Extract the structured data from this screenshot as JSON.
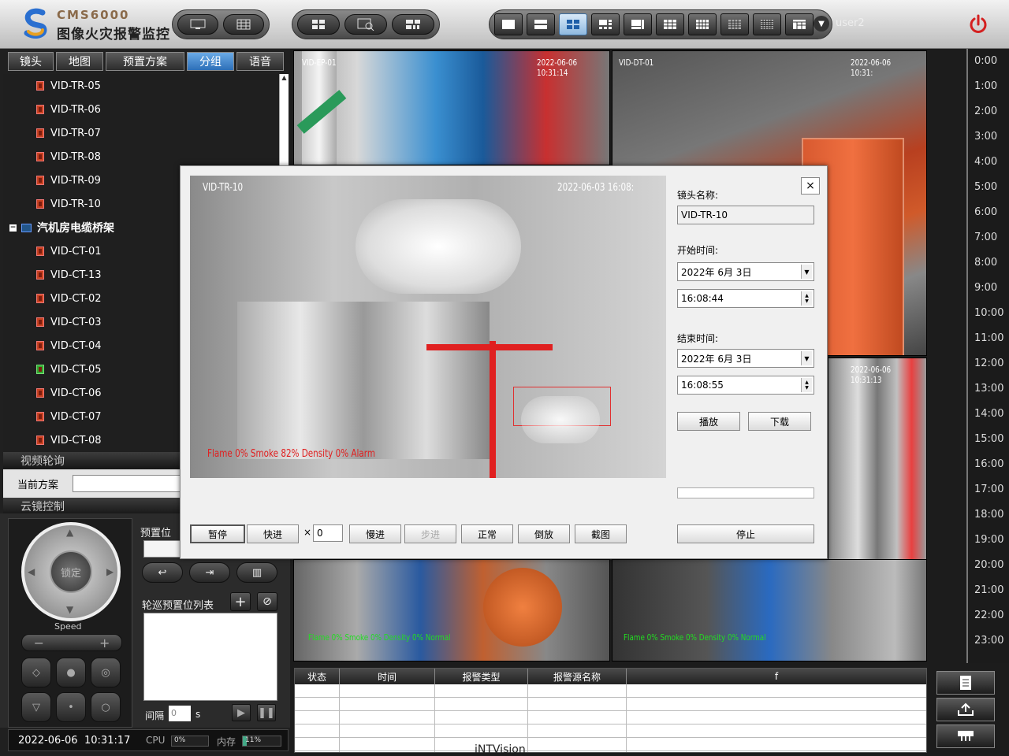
{
  "app": {
    "code": "CMS6000",
    "name": "图像火灾报警监控",
    "user": "user2",
    "footer": "iNTVision"
  },
  "left_tabs": [
    {
      "label": "镜头",
      "active": false
    },
    {
      "label": "地图",
      "active": false
    },
    {
      "label": "预置方案",
      "active": false
    },
    {
      "label": "分组",
      "active": true
    },
    {
      "label": "语音",
      "active": false
    }
  ],
  "tree": {
    "items_tr": [
      "VID-TR-05",
      "VID-TR-06",
      "VID-TR-07",
      "VID-TR-08",
      "VID-TR-09",
      "VID-TR-10"
    ],
    "group": "汽机房电缆桥架",
    "items_ct": [
      "VID-CT-01",
      "VID-CT-13",
      "VID-CT-02",
      "VID-CT-03",
      "VID-CT-04",
      "VID-CT-05",
      "VID-CT-06",
      "VID-CT-07",
      "VID-CT-08"
    ]
  },
  "sections": {
    "patrol": "视频轮询",
    "current_plan": "当前方案",
    "ptz": "云镜控制"
  },
  "ptz": {
    "lock": "锁定",
    "speed": "Speed",
    "preset": "预置位",
    "patrol_list": "轮巡预置位列表",
    "interval_label": "间隔",
    "interval_value": "0",
    "interval_unit": "s"
  },
  "status": {
    "date": "2022-06-06",
    "time": "10:31:17",
    "cpu_label": "CPU",
    "cpu_value": "0%",
    "cpu_level": 0,
    "mem_label": "内存",
    "mem_value": "11%",
    "mem_level": 0.11
  },
  "videos": {
    "v1": {
      "name": "VID-EP-01",
      "ts": "2022-06-06 10:31:14"
    },
    "v2": {
      "name": "VID-DT-01",
      "ts": "2022-06-06 10:31:"
    },
    "v4": {
      "ts": "2022-06-06 10:31:13"
    },
    "v5": {
      "stat": "Flame 0% Smoke 0% Density 0% Normal"
    },
    "v6": {
      "stat": "Flame 0% Smoke 0% Density 0% Normal"
    }
  },
  "timeline": [
    "0:00",
    "1:00",
    "2:00",
    "3:00",
    "4:00",
    "5:00",
    "6:00",
    "7:00",
    "8:00",
    "9:00",
    "10:00",
    "11:00",
    "12:00",
    "13:00",
    "14:00",
    "15:00",
    "16:00",
    "17:00",
    "18:00",
    "19:00",
    "20:00",
    "21:00",
    "22:00",
    "23:00"
  ],
  "alarm_table": {
    "headers": [
      "状态",
      "时间",
      "报警类型",
      "报警源名称",
      "f"
    ]
  },
  "dialog": {
    "video": {
      "name": "VID-TR-10",
      "ts": "2022-06-03 16:08:",
      "stat": "Flame 0% Smoke 82% Density 0% Alarm"
    },
    "camera_label": "镜头名称:",
    "camera_value": "VID-TR-10",
    "start_label": "开始时间:",
    "start_date": "2022年  6月  3日",
    "start_time": "16:08:44",
    "end_label": "结束时间:",
    "end_date": "2022年  6月  3日",
    "end_time": "16:08:55",
    "play": "播放",
    "download": "下载",
    "controls": {
      "pause": "暂停",
      "fast": "快进",
      "times": "×",
      "speed_value": "0",
      "slow": "慢进",
      "step": "步进",
      "normal": "正常",
      "reverse": "倒放",
      "capture": "截图",
      "stop": "停止"
    }
  },
  "colors": {
    "accent": "#2d6fb8",
    "alarm_red": "#e02020",
    "normal_green": "#22dd22"
  }
}
